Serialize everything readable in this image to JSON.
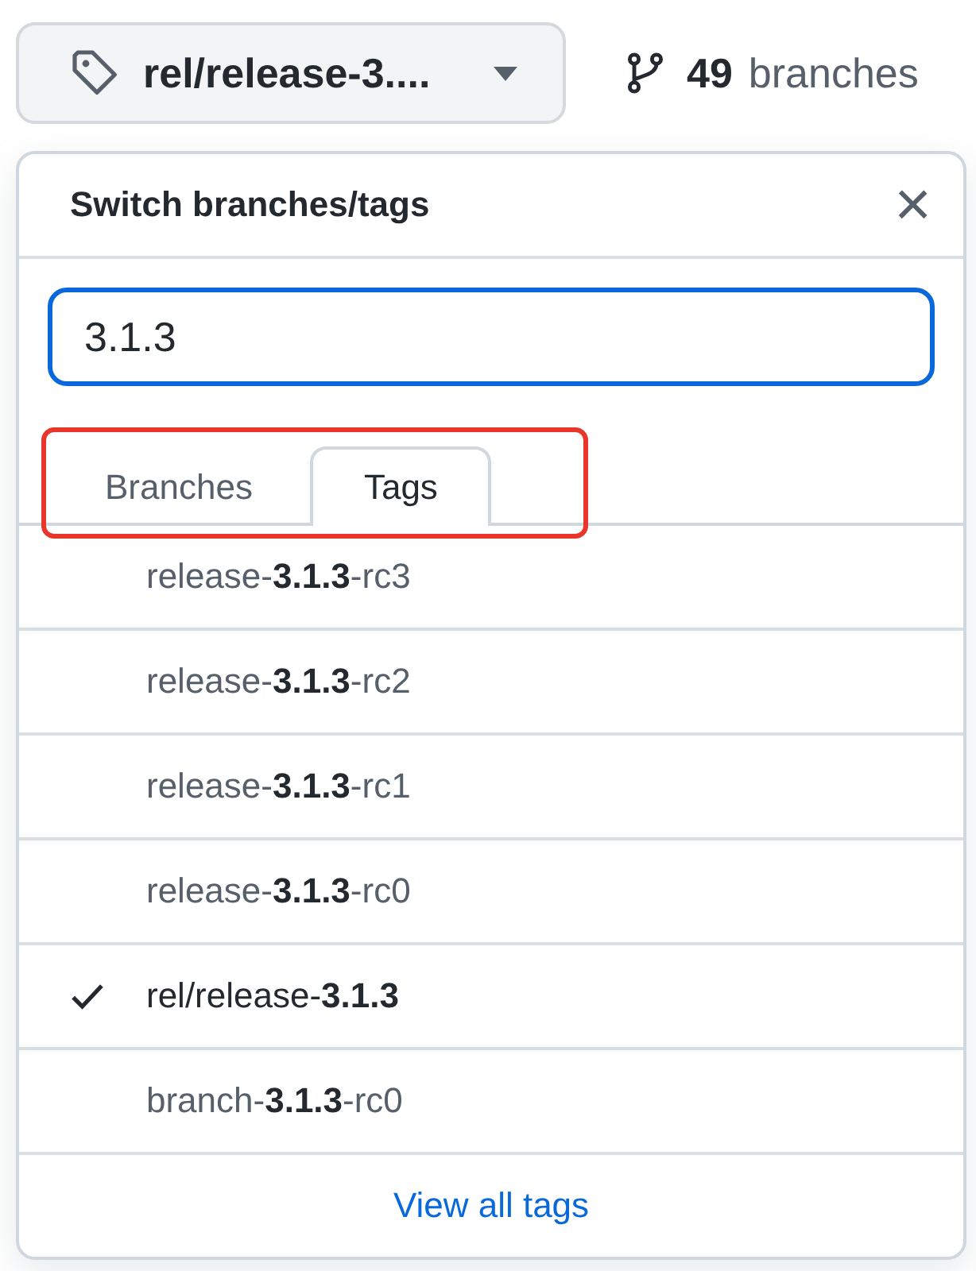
{
  "ref_button": {
    "label": "rel/release-3...."
  },
  "branch_count": {
    "count": "49",
    "label": "branches"
  },
  "dropdown": {
    "title": "Switch branches/tags",
    "close": "×",
    "filter": {
      "value": "3.1.3"
    },
    "tabs": [
      {
        "label": "Branches",
        "selected": false
      },
      {
        "label": "Tags",
        "selected": true
      }
    ],
    "items": [
      {
        "name": "release-**3.1.3**-rc3",
        "selected": false
      },
      {
        "name": "release-**3.1.3**-rc2",
        "selected": false
      },
      {
        "name": "release-**3.1.3**-rc1",
        "selected": false
      },
      {
        "name": "release-**3.1.3**-rc0",
        "selected": false
      },
      {
        "name": "rel/release-**3.1.3**",
        "selected": true
      },
      {
        "name": "branch-**3.1.3**-rc0",
        "selected": false
      }
    ],
    "footer_link": "View all tags"
  }
}
